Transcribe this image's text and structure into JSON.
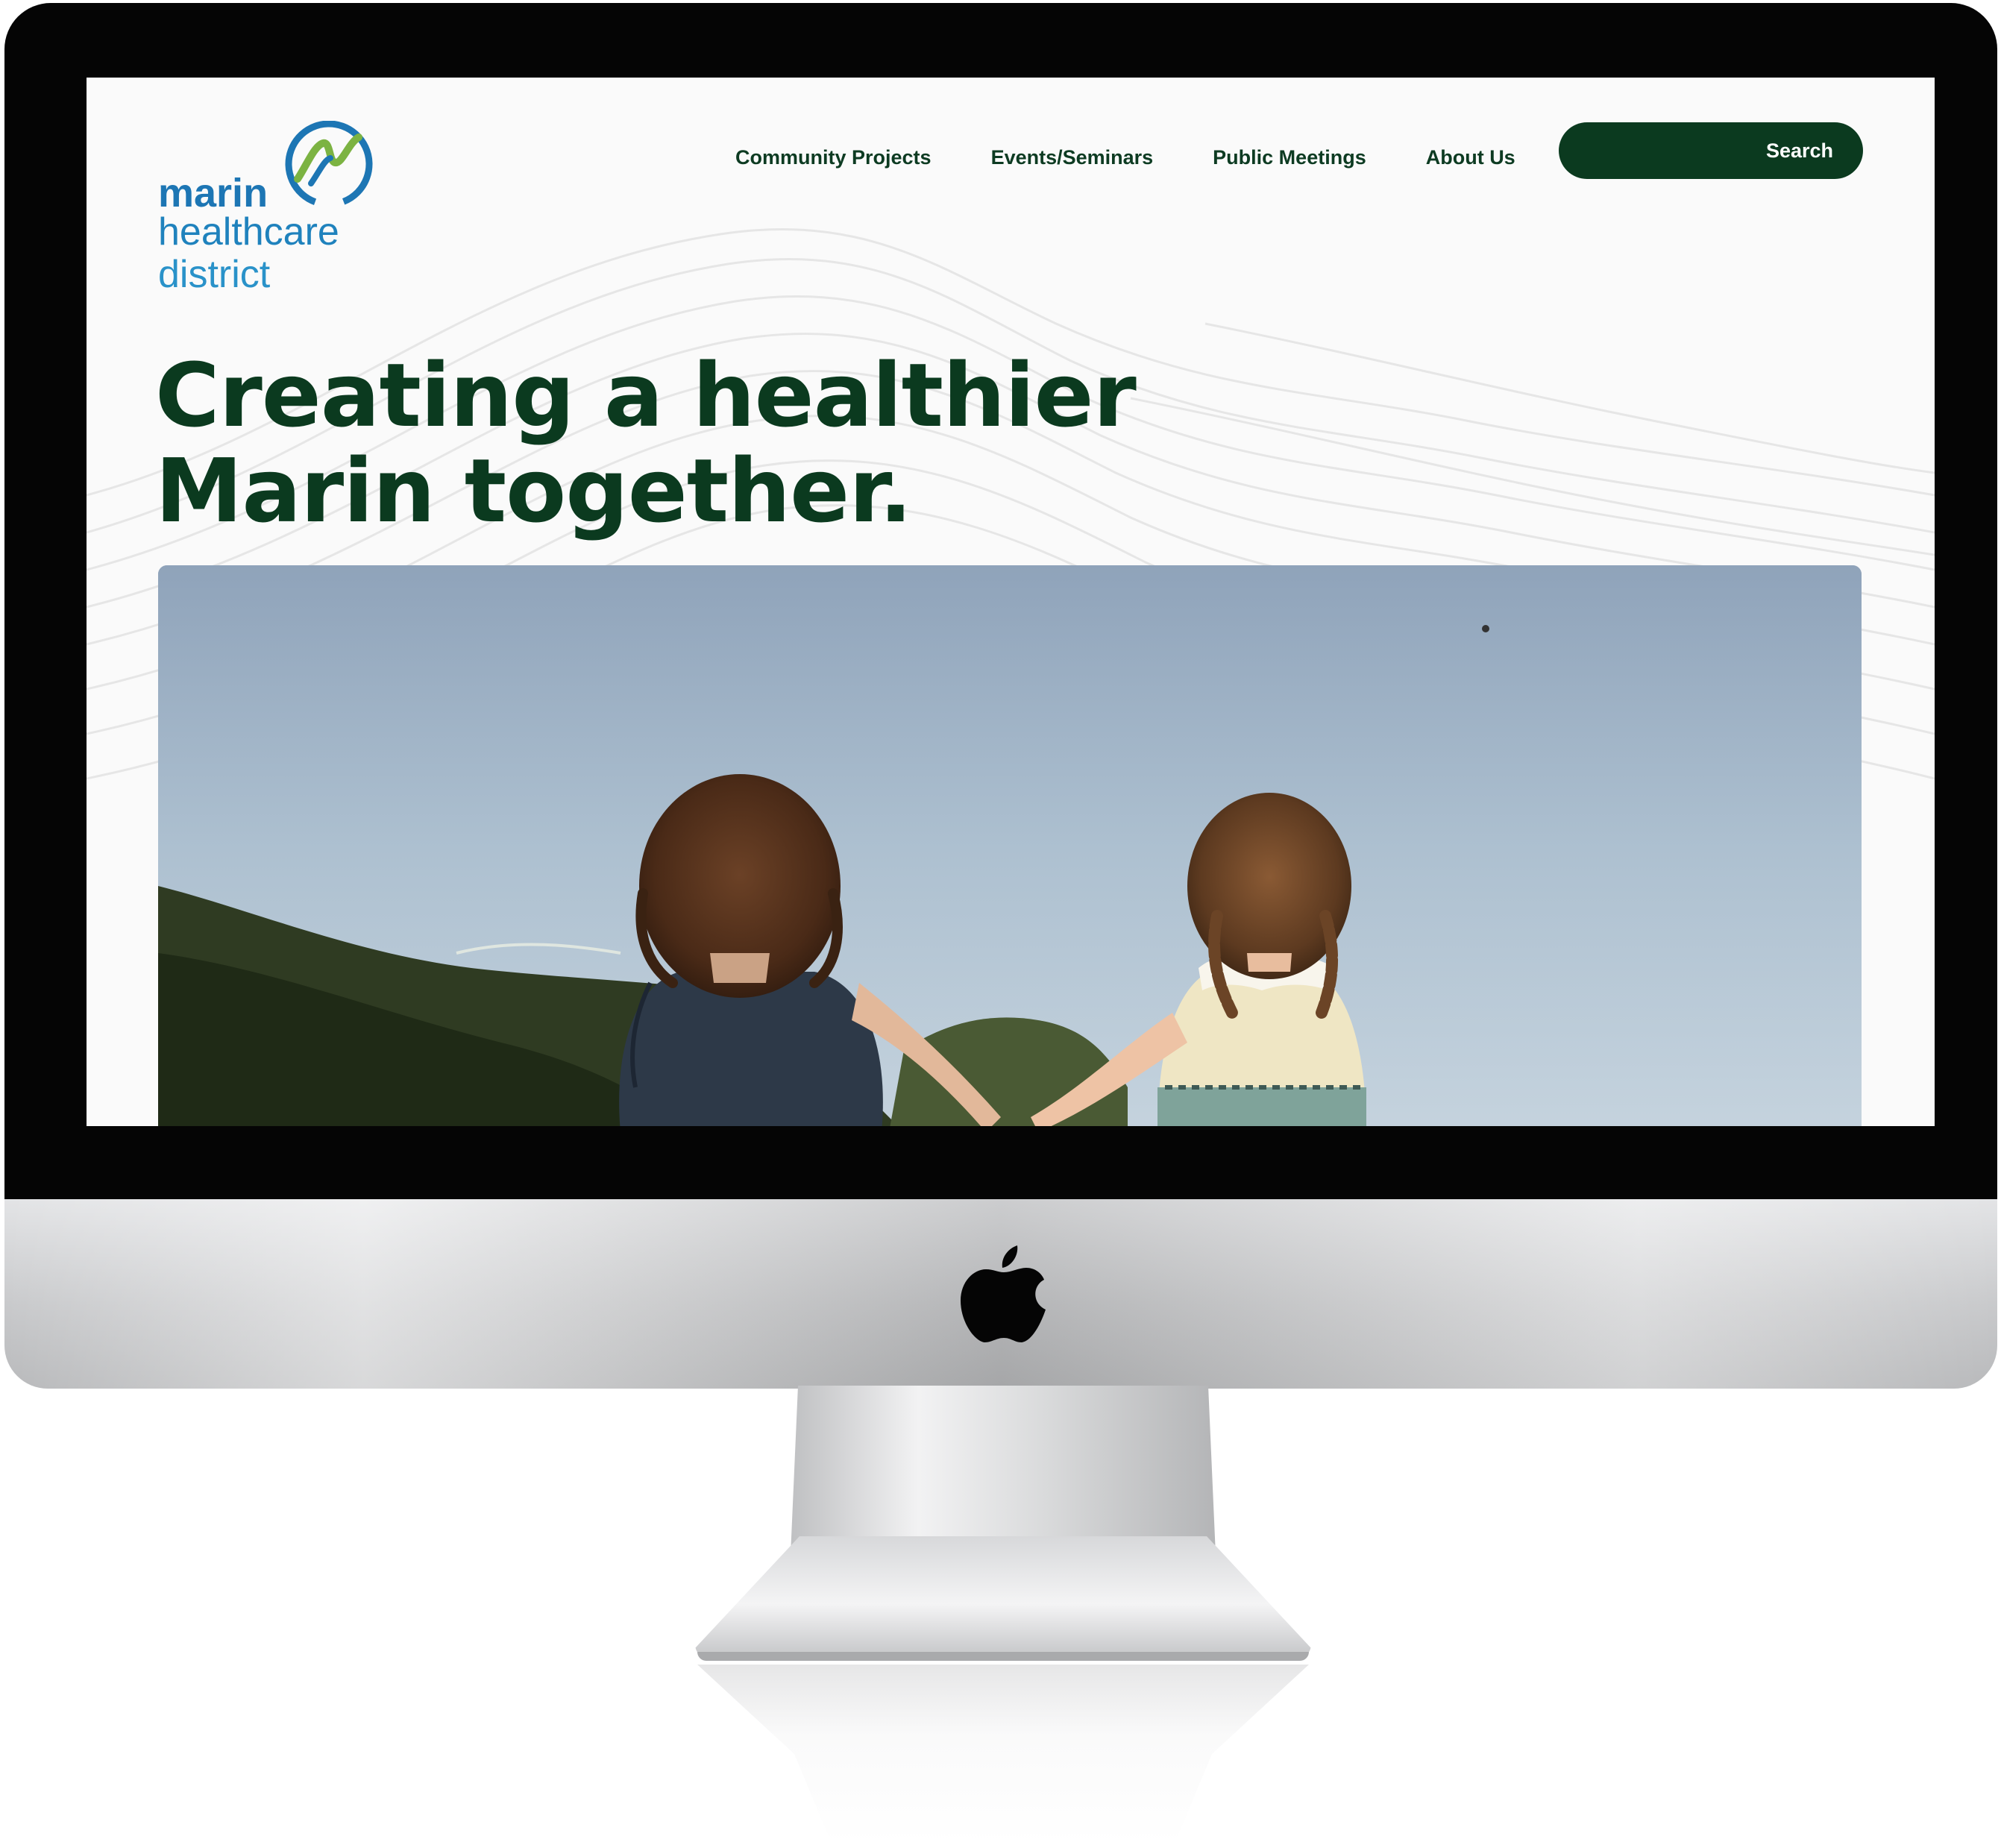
{
  "logo": {
    "line1": "marin",
    "line2": "healthcare",
    "line3": "district"
  },
  "nav": {
    "items": [
      {
        "label": "Community Projects"
      },
      {
        "label": "Events/Seminars"
      },
      {
        "label": "Public Meetings"
      },
      {
        "label": "About Us"
      }
    ],
    "search_label": "Search"
  },
  "hero": {
    "headline_line1": "Creating a healthier",
    "headline_line2": "Marin together."
  },
  "colors": {
    "brand_dark_green": "#0b3a1f",
    "logo_blue": "#1d76b4",
    "logo_green": "#7cb342",
    "page_background": "#fafafa"
  },
  "icons": {
    "logo_mark": "marin-wave-circle-logo",
    "device_logo": "apple-logo"
  }
}
